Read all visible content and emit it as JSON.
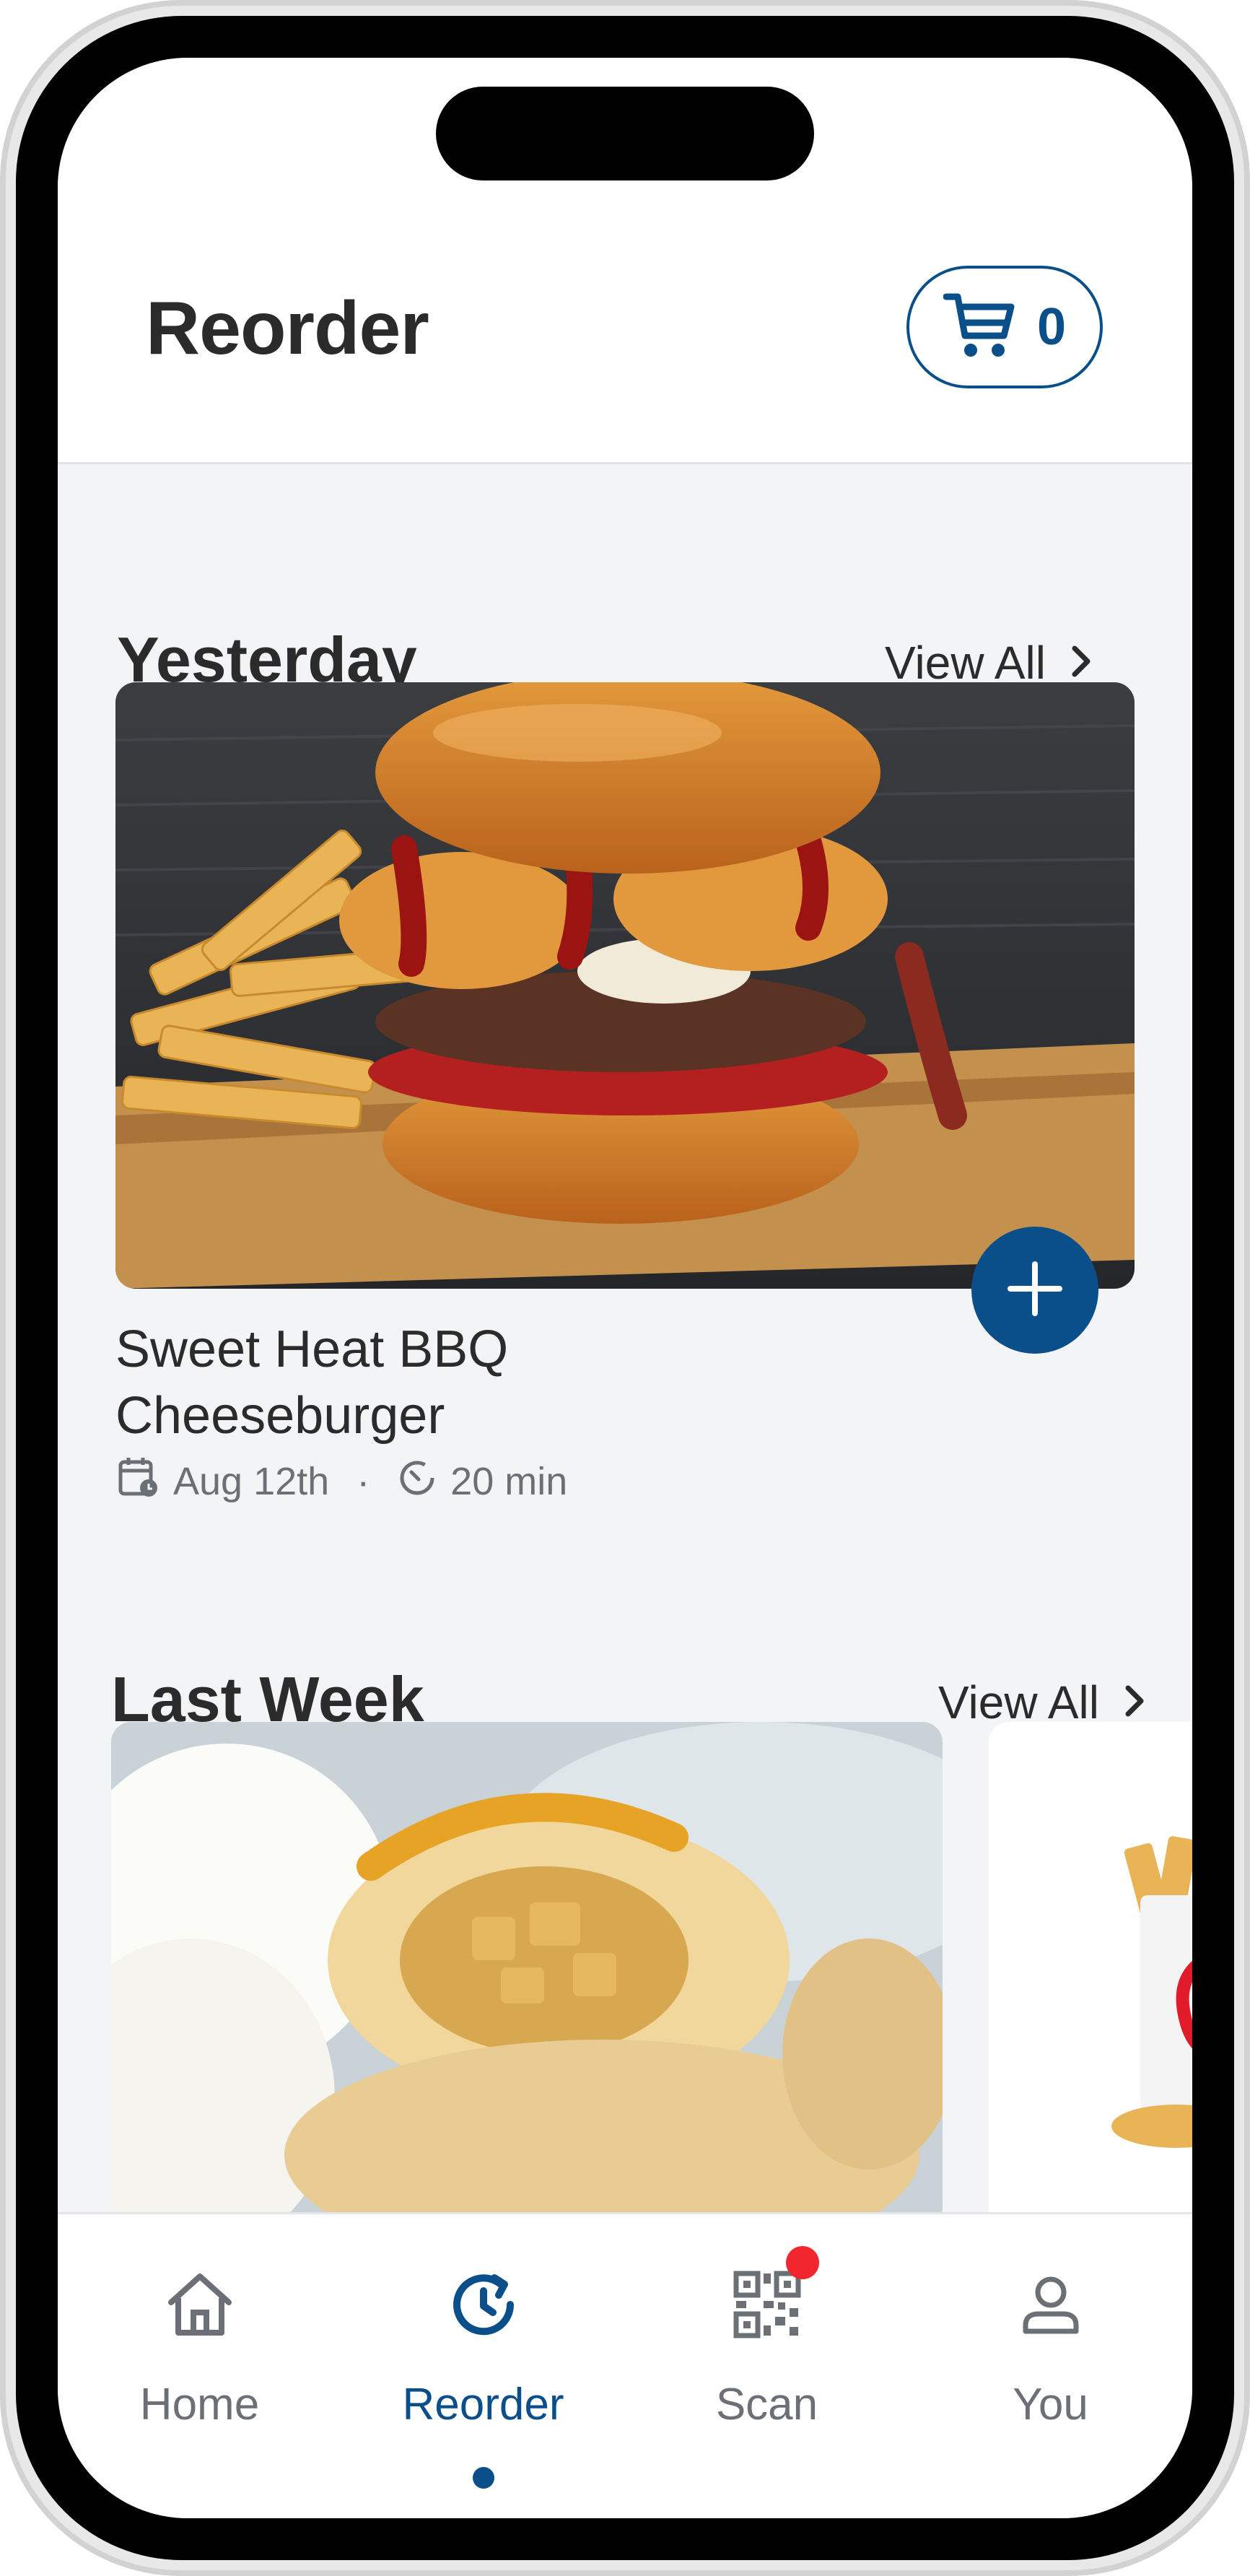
{
  "header": {
    "title": "Reorder",
    "cart_count": "0"
  },
  "sections": [
    {
      "title": "Yesterday",
      "view_all": "View All",
      "item": {
        "name_line1": "Sweet Heat BBQ",
        "name_line2": "Cheeseburger",
        "date": "Aug 12th",
        "duration": "20 min"
      }
    },
    {
      "title": "Last Week",
      "view_all": "View All"
    }
  ],
  "tabs": [
    {
      "label": "Home",
      "icon": "home-icon"
    },
    {
      "label": "Reorder",
      "icon": "reorder-clock-icon",
      "active": true
    },
    {
      "label": "Scan",
      "icon": "qr-code-icon",
      "badge": true
    },
    {
      "label": "You",
      "icon": "user-icon"
    }
  ],
  "colors": {
    "accent": "#0b4f8a",
    "text": "#2b2b2b",
    "muted": "#6b6f76",
    "background": "#f3f4f6",
    "badge": "#f2262e"
  }
}
